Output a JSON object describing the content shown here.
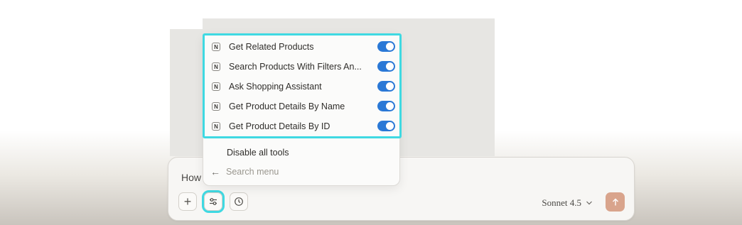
{
  "composer": {
    "text": "How",
    "model_label": "Sonnet 4.5",
    "icons": {
      "plus": "plus-icon",
      "tools": "sliders-icon",
      "history": "clock-icon",
      "send": "arrow-up-icon"
    }
  },
  "colors": {
    "accent_toggle": "#2a78d6",
    "highlight": "#3fd9e2",
    "send_button": "#d9a48c"
  },
  "menu": {
    "tools": [
      {
        "badge": "N",
        "label": "Get Related Products",
        "enabled": true
      },
      {
        "badge": "N",
        "label": "Search Products With Filters An...",
        "enabled": true
      },
      {
        "badge": "N",
        "label": "Ask Shopping Assistant",
        "enabled": true
      },
      {
        "badge": "N",
        "label": "Get Product Details By Name",
        "enabled": true
      },
      {
        "badge": "N",
        "label": "Get Product Details By ID",
        "enabled": true
      }
    ],
    "disable_all": "Disable all tools",
    "search_placeholder": "Search menu"
  }
}
